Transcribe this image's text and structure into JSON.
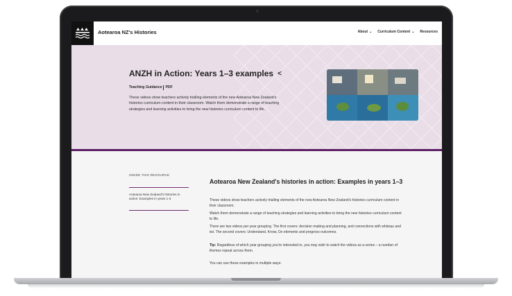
{
  "site": {
    "title": "Aotearoa NZ's Histories",
    "nav": [
      "About",
      "Curriculum Content",
      "Resources"
    ],
    "nav_chevron": "chevron-down-icon"
  },
  "hero": {
    "title": "ANZH in Action: Years 1–3 examples",
    "meta": [
      "Teaching Guidance",
      "PDF"
    ],
    "description": "These videos show teachers actively trialling elements of the new Aotearoa New Zealand's histories curriculum content in their classroom. Watch them demonstrate a range of teaching strategies and learning activities to bring the new histories curriculum content to life.",
    "background_color": "#e9dde8",
    "accent_color": "#5b1c64"
  },
  "sidebar": {
    "label": "INSIDE THIS RESOURCE",
    "link": "Aotearoa New Zealand's histories in action: Examples in years 1-3"
  },
  "main": {
    "heading": "Aotearoa New Zealand's histories in action: Examples in years 1–3",
    "p1": "These videos show teachers actively trialling elements of the new Aotearoa New Zealand's histories curriculum content in their classroom.",
    "p2": "Watch them demonstrate a range of teaching strategies and learning activities to bring the new histories curriculum content to life.",
    "p3": "There are two videos per year grouping. The first covers: decision making and planning, and connections with whānau and iwi. The second covers: Understand, Know, Do elements and progress outcomes.",
    "tip_label": "Tip:",
    "tip_text": " Regardless of which year grouping you're interested in, you may wish to watch the videos as a series – a number of themes repeat across them.",
    "p5": "You can use these examples in multiple ways:"
  }
}
